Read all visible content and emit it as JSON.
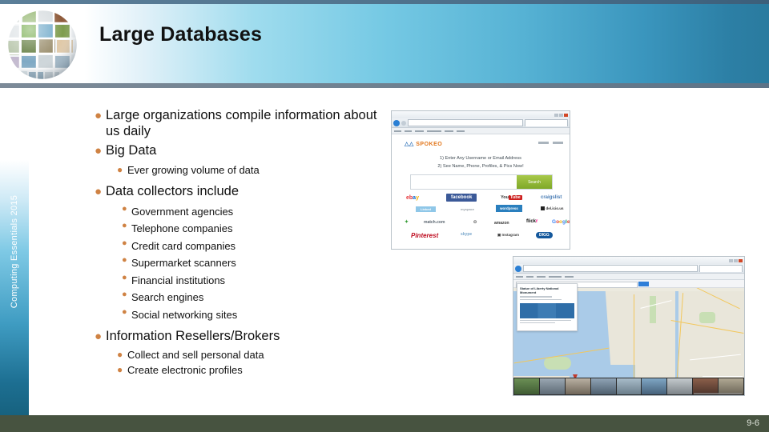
{
  "slide": {
    "title": "Large Databases",
    "page_number": "9-6",
    "sidebar_text": "Computing Essentials 2015",
    "logo_name": "photo-globe-logo"
  },
  "colors": {
    "bullet": "#cf8243",
    "header_light": "#9fdcee",
    "header_dark": "#2a7b9f",
    "footer": "#475340",
    "title_text": "#111111"
  },
  "content": [
    {
      "level": 1,
      "text": "Large organizations compile information about us daily"
    },
    {
      "level": 1,
      "text": "Big Data"
    },
    {
      "level": 2,
      "text": "Ever growing volume of data"
    },
    {
      "level": 1,
      "text": "Data collectors include"
    },
    {
      "level": 3,
      "text": "Government agencies"
    },
    {
      "level": 3,
      "text": "Telephone companies"
    },
    {
      "level": 3,
      "text": "Credit card companies"
    },
    {
      "level": 3,
      "text": "Supermarket scanners"
    },
    {
      "level": 3,
      "text": "Financial institutions"
    },
    {
      "level": 3,
      "text": "Search engines"
    },
    {
      "level": 3,
      "text": "Social networking sites"
    },
    {
      "level": 1,
      "text": "Information Resellers/Brokers"
    },
    {
      "level": 2,
      "text": "Collect and sell personal data"
    },
    {
      "level": 2,
      "text": "Create electronic profiles"
    }
  ],
  "screenshots": {
    "spokeo": {
      "name": "spokeo-website-screenshot",
      "brand": "SPOKEO",
      "headline_1": "1) Enter Any Username or Email Address",
      "headline_2": "2) See Name, Phone, Profiles, & Pics Now!",
      "search_button": "Search",
      "search_placeholder": "",
      "partner_logos": [
        "ebay",
        "facebook",
        "YouTube",
        "Craigslist",
        "LinkedIn",
        "MySpace",
        "WordPress",
        "del.icio.us",
        "match.com",
        "amazon",
        "flickr",
        "Google",
        "Pinterest",
        "Instagram",
        "DIGG"
      ]
    },
    "map": {
      "name": "online-map-screenshot",
      "place_title": "Statue of Liberty National Monument",
      "search_placeholder": ""
    }
  }
}
